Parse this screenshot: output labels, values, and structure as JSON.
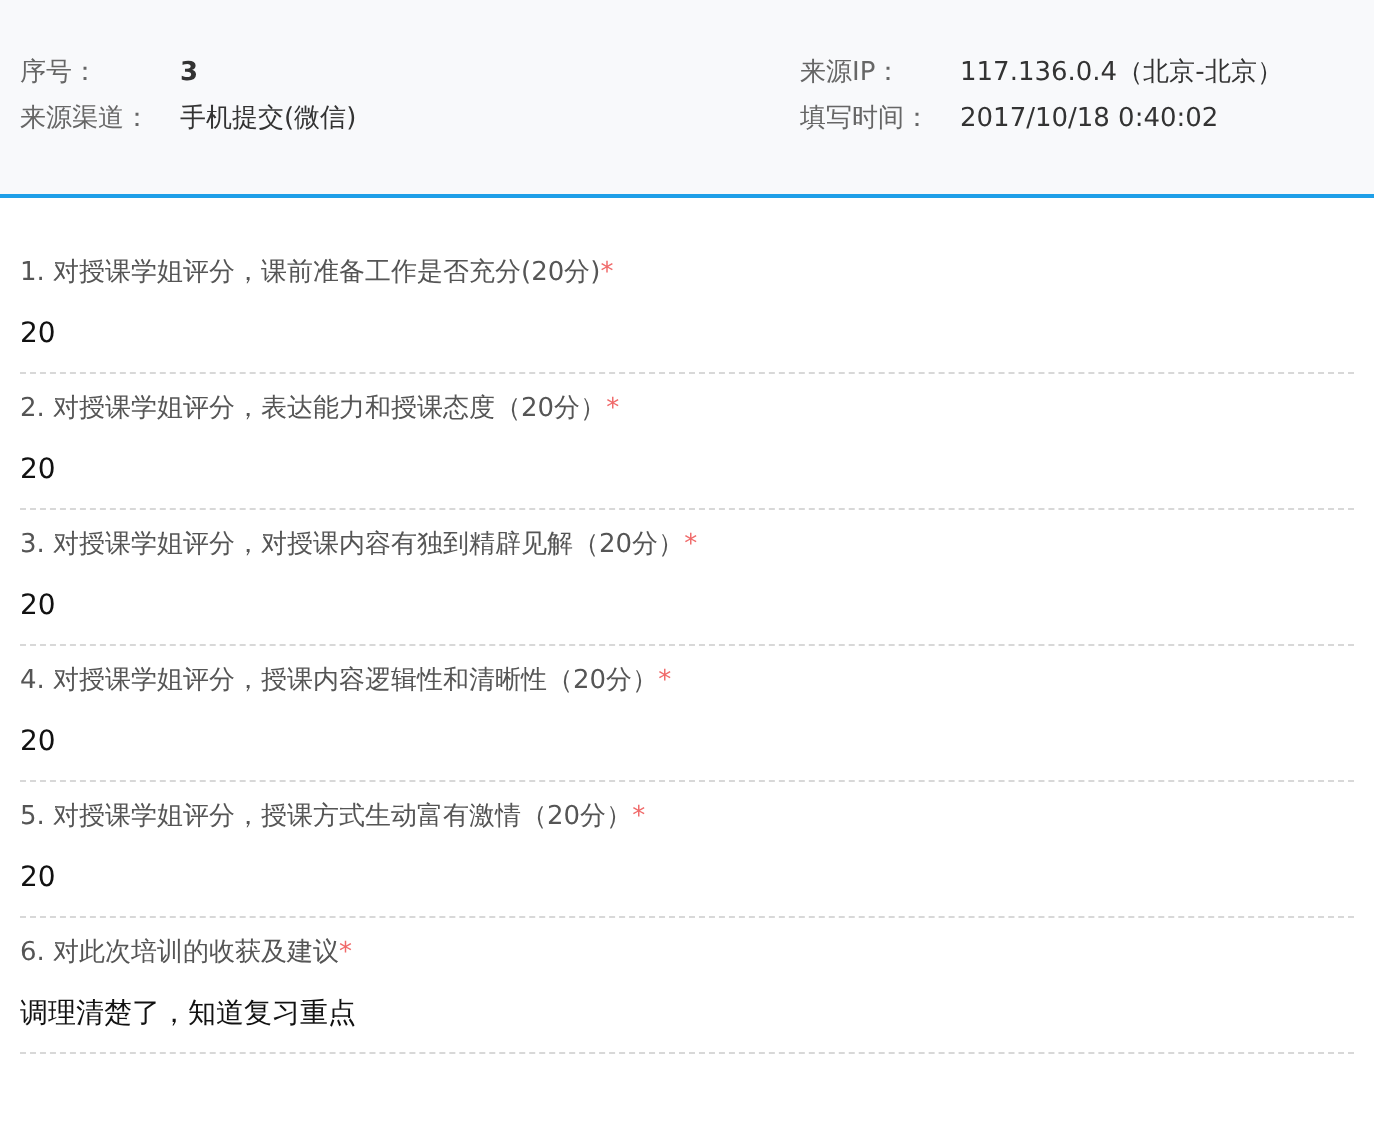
{
  "header": {
    "left": [
      {
        "label": "序号：",
        "value": "3",
        "bold": true
      },
      {
        "label": "来源渠道：",
        "value": "手机提交(微信)",
        "bold": false
      }
    ],
    "right": [
      {
        "label": "来源IP：",
        "value": "117.136.0.4（北京-北京）",
        "bold": false
      },
      {
        "label": "填写时间：",
        "value": "2017/10/18 0:40:02",
        "bold": false
      }
    ]
  },
  "questions": [
    {
      "title": "1. 对授课学姐评分，课前准备工作是否充分(20分)",
      "required_mark": "*",
      "answer": "20"
    },
    {
      "title": "2. 对授课学姐评分，表达能力和授课态度（20分）",
      "required_mark": "*",
      "answer": "20"
    },
    {
      "title": "3. 对授课学姐评分，对授课内容有独到精辟见解（20分）",
      "required_mark": "*",
      "answer": "20"
    },
    {
      "title": "4. 对授课学姐评分，授课内容逻辑性和清晰性（20分）",
      "required_mark": "*",
      "answer": "20"
    },
    {
      "title": "5. 对授课学姐评分，授课方式生动富有激情（20分）",
      "required_mark": "*",
      "answer": "20"
    },
    {
      "title": "6. 对此次培训的收获及建议",
      "required_mark": "*",
      "answer": "调理清楚了，知道复习重点"
    }
  ]
}
